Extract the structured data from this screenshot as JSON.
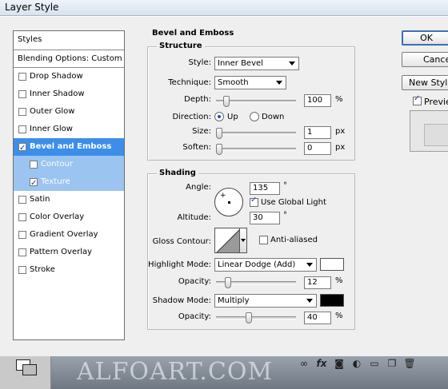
{
  "window": {
    "title": "Layer Style"
  },
  "styles_list": {
    "header": "Styles",
    "blending": "Blending Options: Custom",
    "items": [
      {
        "label": "Drop Shadow",
        "checked": false
      },
      {
        "label": "Inner Shadow",
        "checked": false
      },
      {
        "label": "Outer Glow",
        "checked": false
      },
      {
        "label": "Inner Glow",
        "checked": false
      },
      {
        "label": "Bevel and Emboss",
        "checked": true,
        "selected": true
      },
      {
        "label": "Contour",
        "checked": false,
        "sub": true
      },
      {
        "label": "Texture",
        "checked": true,
        "sub": true
      },
      {
        "label": "Satin",
        "checked": false
      },
      {
        "label": "Color Overlay",
        "checked": false
      },
      {
        "label": "Gradient Overlay",
        "checked": false
      },
      {
        "label": "Pattern Overlay",
        "checked": false
      },
      {
        "label": "Stroke",
        "checked": false
      }
    ]
  },
  "bevel": {
    "title": "Bevel and Emboss",
    "structure": {
      "title": "Structure",
      "style_label": "Style:",
      "style_value": "Inner Bevel",
      "technique_label": "Technique:",
      "technique_value": "Smooth",
      "depth_label": "Depth:",
      "depth_value": "100",
      "depth_unit": "%",
      "depth_level": 0.1,
      "direction_label": "Direction:",
      "direction_up": "Up",
      "direction_down": "Down",
      "size_label": "Size:",
      "size_value": "1",
      "size_unit": "px",
      "size_level": 0.0,
      "soften_label": "Soften:",
      "soften_value": "0",
      "soften_unit": "px",
      "soften_level": 0.0
    },
    "shading": {
      "title": "Shading",
      "angle_label": "Angle:",
      "angle_value": "135",
      "angle_unit": "°",
      "use_global_light": "Use Global Light",
      "altitude_label": "Altitude:",
      "altitude_value": "30",
      "altitude_unit": "°",
      "gloss_label": "Gloss Contour:",
      "anti_aliased": "Anti-aliased",
      "highlight_label": "Highlight Mode:",
      "highlight_value": "Linear Dodge (Add)",
      "highlight_color": "#ffffff",
      "highlight_opacity_label": "Opacity:",
      "highlight_opacity_value": "12",
      "highlight_opacity_level": 0.12,
      "opacity_unit": "%",
      "shadow_label": "Shadow Mode:",
      "shadow_value": "Multiply",
      "shadow_color": "#000000",
      "shadow_opacity_label": "Opacity:",
      "shadow_opacity_value": "40",
      "shadow_opacity_level": 0.4
    }
  },
  "buttons": {
    "ok": "OK",
    "cancel": "Cancel",
    "new_style": "New Style...",
    "preview": "Preview"
  },
  "watermark": "ALFOART.COM"
}
